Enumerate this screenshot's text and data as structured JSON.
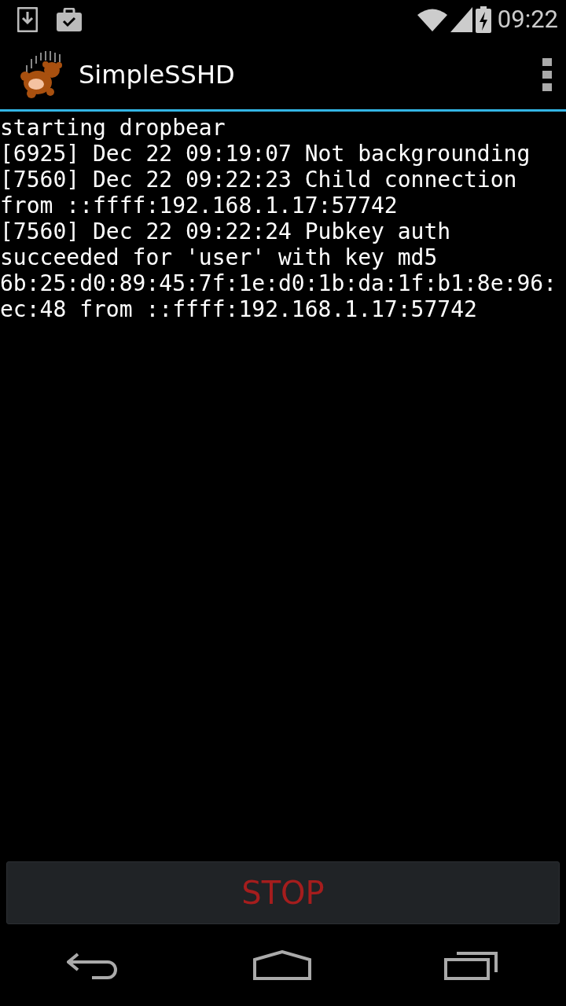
{
  "status_bar": {
    "time": "09:22"
  },
  "action_bar": {
    "title": "SimpleSSHD"
  },
  "log": [
    "starting dropbear",
    "[6925] Dec 22 09:19:07 Not backgrounding",
    "[7560] Dec 22 09:22:23 Child connection from ::ffff:192.168.1.17:57742",
    "[7560] Dec 22 09:22:24 Pubkey auth succeeded for 'user' with key md5 6b:25:d0:89:45:7f:1e:d0:1b:da:1f:b1:8e:96:ec:48 from ::ffff:192.168.1.17:57742"
  ],
  "button": {
    "label": "STOP"
  }
}
